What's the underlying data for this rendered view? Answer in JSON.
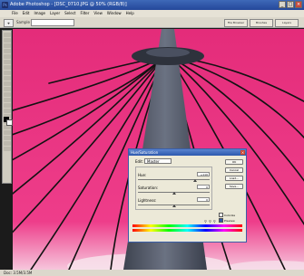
{
  "window": {
    "title": "Adobe Photoshop - [DSC_0710.JPG @ 50% (RGB/8)]",
    "icon": "photoshop-app-icon",
    "controls": [
      "_",
      "□",
      "×"
    ]
  },
  "menu": [
    "File",
    "Edit",
    "Image",
    "Layer",
    "Select",
    "Filter",
    "View",
    "Window",
    "Help"
  ],
  "options_bar": {
    "tool": "⌖",
    "label": "Sample Size:",
    "right_buttons": [
      "File Browser",
      "Brushes",
      "Layers"
    ]
  },
  "status": "Doc: 3.5M/3.5M",
  "dialog": {
    "title": "Hue/Saturation",
    "close": "×",
    "edit_label": "Edit:",
    "edit_value": "Master",
    "sliders": [
      {
        "name": "Hue:",
        "value": "+110",
        "fraction": 0.8
      },
      {
        "name": "Saturation:",
        "value": "0",
        "fraction": 0.5
      },
      {
        "name": "Lightness:",
        "value": "0",
        "fraction": 0.5
      }
    ],
    "buttons": [
      "OK",
      "Cancel",
      "Load...",
      "Save..."
    ],
    "checkboxes": [
      {
        "label": "Colorize",
        "checked": false
      },
      {
        "label": "Preview",
        "checked": true
      }
    ],
    "dropper_icons": [
      "eyedropper-icon",
      "eyedropper-plus-icon",
      "eyedropper-minus-icon"
    ]
  },
  "colors": {
    "sky": "#e5307c",
    "cables": "#111111",
    "mast": "#5b6170"
  }
}
